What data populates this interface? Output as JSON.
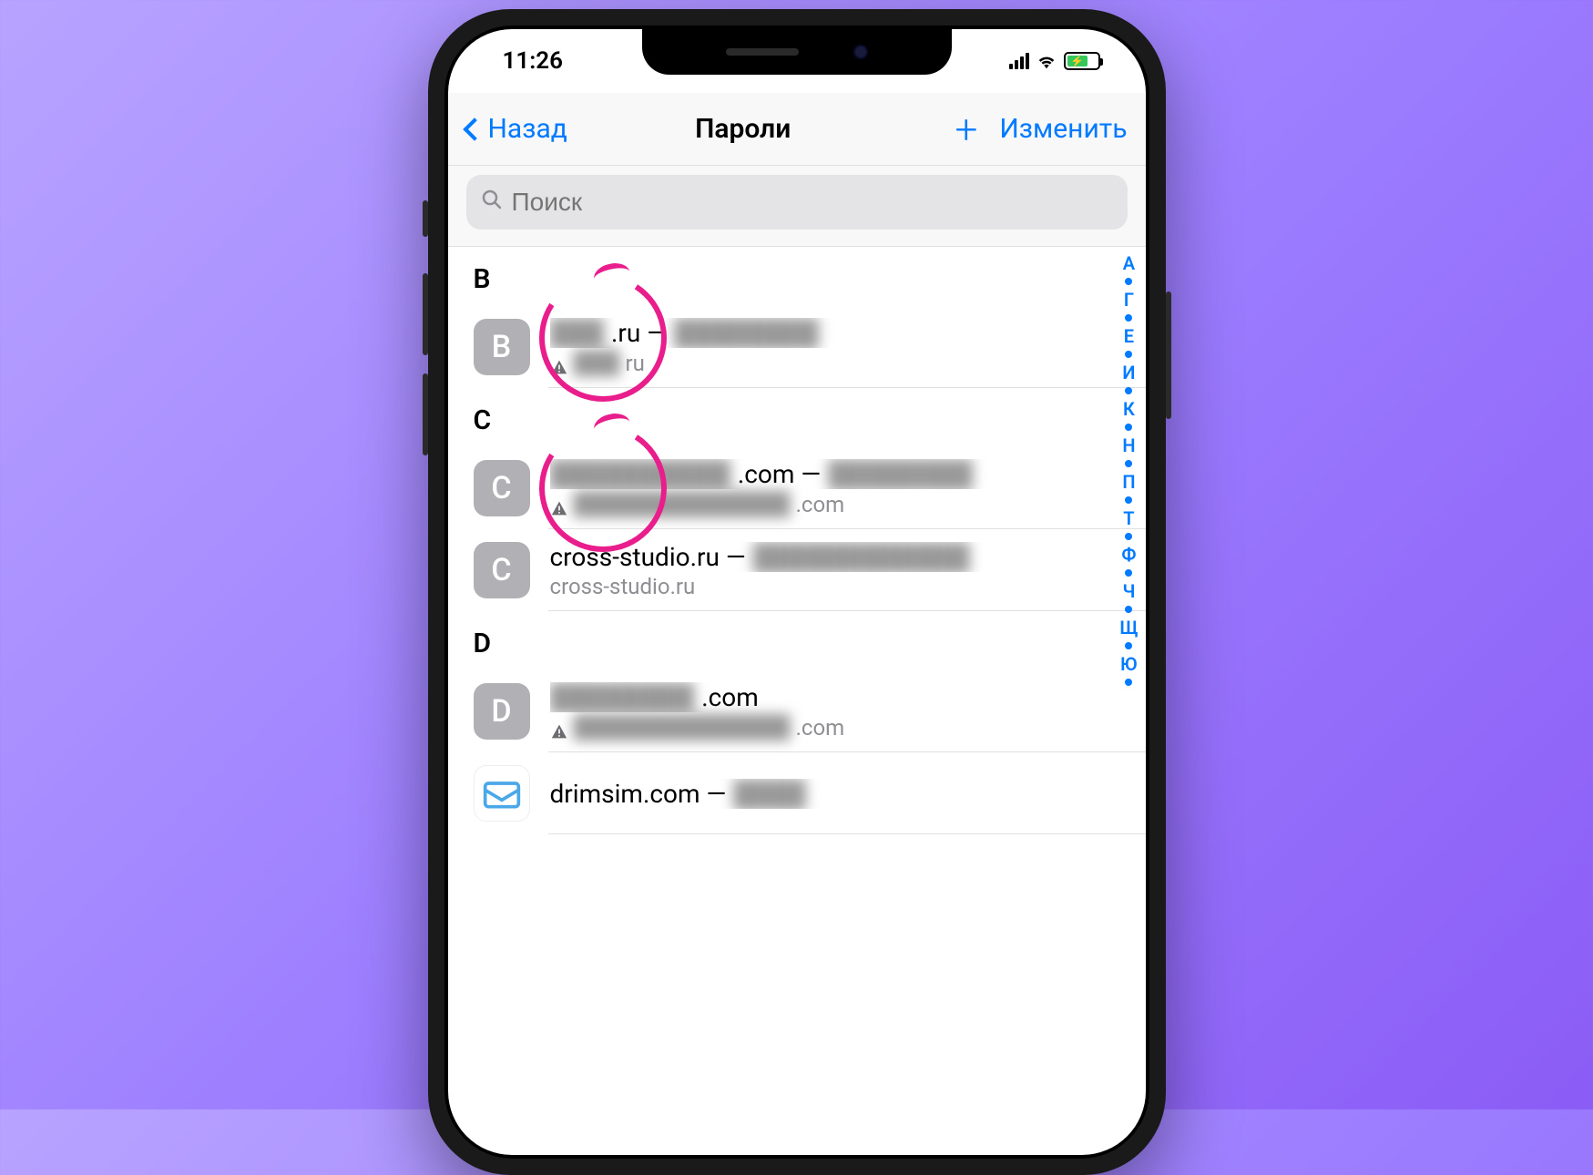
{
  "status": {
    "time": "11:26"
  },
  "nav": {
    "back": "Назад",
    "title": "Пароли",
    "edit": "Изменить"
  },
  "search": {
    "placeholder": "Поиск"
  },
  "sections": [
    {
      "letter": "B",
      "rows": [
        {
          "icon_letter": "B",
          "title_html": "<span class='blur'>███</span>.ru — <span class='blur'>████████</span>",
          "sub_html": "<span class='warn'></span> <span class='blur'>███</span>ru",
          "has_warning": true,
          "annotated": true
        }
      ]
    },
    {
      "letter": "C",
      "rows": [
        {
          "icon_letter": "C",
          "title_html": "<span class='blur'>██████████</span>.com — <span class='blur'>████████</span>",
          "sub_html": "<span class='warn'></span> <span class='blur'>██████████████</span>.com",
          "has_warning": true,
          "annotated": true
        },
        {
          "icon_letter": "C",
          "title_html": "cross-studio.ru — <span class='blur'>████████████</span>",
          "sub_html": "cross-studio.ru",
          "has_warning": false,
          "annotated": false
        }
      ]
    },
    {
      "letter": "D",
      "rows": [
        {
          "icon_letter": "D",
          "title_html": "<span class='blur'>████████</span>.com",
          "sub_html": "<span class='warn'></span> <span class='blur'>██████████████</span>.com",
          "has_warning": true,
          "annotated": false
        },
        {
          "icon_letter": "",
          "icon_image": true,
          "title_html": "drimsim.com — <span class='blur'>████</span>",
          "sub_html": "",
          "has_warning": false,
          "annotated": false
        }
      ]
    }
  ],
  "index_letters": [
    "А",
    "Г",
    "Е",
    "И",
    "К",
    "Н",
    "П",
    "Т",
    "Ф",
    "Ч",
    "Щ",
    "Ю"
  ]
}
